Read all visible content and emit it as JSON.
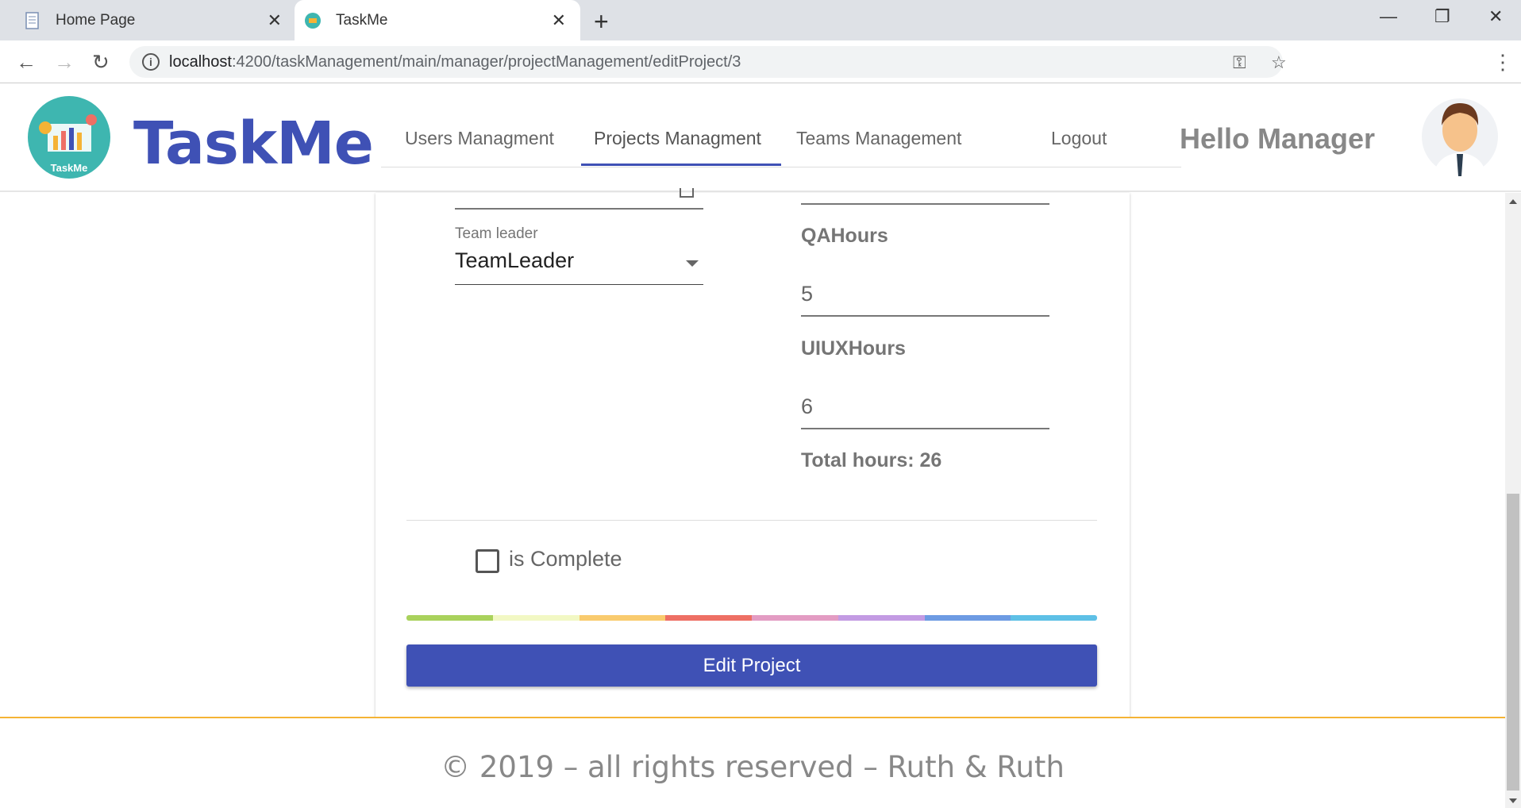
{
  "browser": {
    "tabs": [
      {
        "title": "Home Page",
        "active": false
      },
      {
        "title": "TaskMe",
        "active": true
      }
    ],
    "url_host": "localhost",
    "url_path": ":4200/taskManagement/main/manager/projectManagement/editProject/3"
  },
  "header": {
    "logo_text": "TaskMe",
    "brand": "TaskMe",
    "nav": [
      {
        "label": "Users Managment"
      },
      {
        "label": "Projects Managment",
        "active": true
      },
      {
        "label": "Teams Management"
      },
      {
        "label": "Logout"
      }
    ],
    "greeting": "Hello Manager"
  },
  "form": {
    "team_leader_label": "Team leader",
    "team_leader_value": "TeamLeader",
    "qa_hours_label": "QAHours",
    "qa_hours_value": "5",
    "uiux_hours_label": "UIUXHours",
    "uiux_hours_value": "6",
    "total_hours": "Total hours: 26",
    "is_complete_label": "is Complete",
    "is_complete_checked": false,
    "submit_label": "Edit Project"
  },
  "footer": {
    "copyright": "© 2019 – all rights reserved – Ruth & Ruth"
  },
  "colors": {
    "primary": "#3f51b5",
    "footer_border": "#f5b335",
    "rainbow": [
      "#a9d25c",
      "#f2f8c4",
      "#f9cb6e",
      "#ee6f64",
      "#e39cc3",
      "#c39be3",
      "#6d9be3",
      "#5ec0e6"
    ]
  }
}
